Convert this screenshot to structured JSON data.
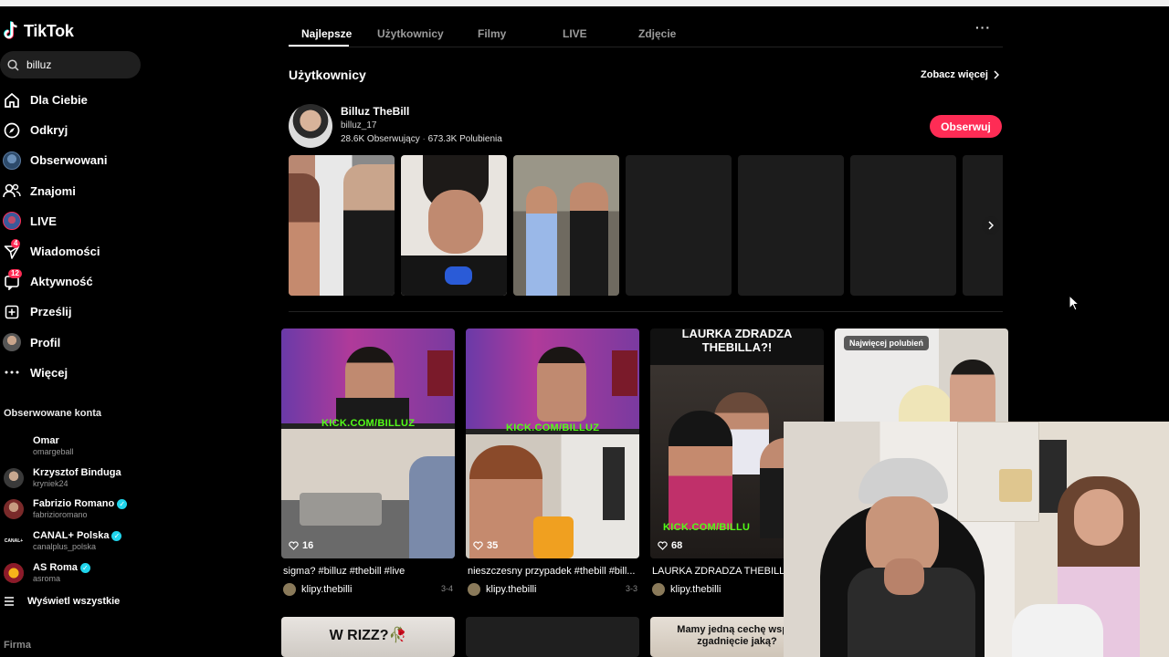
{
  "app": {
    "name": "TikTok"
  },
  "search": {
    "value": "billuz"
  },
  "nav": [
    {
      "label": "Dla Ciebie",
      "icon": "home-icon"
    },
    {
      "label": "Odkryj",
      "icon": "compass-icon"
    },
    {
      "label": "Obserwowani",
      "icon": "avatar-icon"
    },
    {
      "label": "Znajomi",
      "icon": "friends-icon"
    },
    {
      "label": "LIVE",
      "icon": "live-icon"
    },
    {
      "label": "Wiadomości",
      "icon": "send-icon",
      "badge": "4"
    },
    {
      "label": "Aktywność",
      "icon": "activity-icon",
      "badge": "12"
    },
    {
      "label": "Prześlij",
      "icon": "upload-icon"
    },
    {
      "label": "Profil",
      "icon": "profile-avatar-icon"
    },
    {
      "label": "Więcej",
      "icon": "more-icon"
    }
  ],
  "followed": {
    "title": "Obserwowane konta",
    "accounts": [
      {
        "name": "Omar",
        "handle": "omargeball",
        "verified": false
      },
      {
        "name": "Krzysztof Binduga",
        "handle": "kryniek24",
        "verified": false
      },
      {
        "name": "Fabrizio Romano",
        "handle": "fabrizioromano",
        "verified": true
      },
      {
        "name": "CANAL+ Polska",
        "handle": "canalplus_polska",
        "verified": true
      },
      {
        "name": "AS Roma",
        "handle": "asroma",
        "verified": true
      }
    ],
    "show_all": "Wyświetl wszystkie"
  },
  "footer": {
    "company": "Firma"
  },
  "tabs": [
    "Najlepsze",
    "Użytkownicy",
    "Filmy",
    "LIVE",
    "Zdjęcie"
  ],
  "tabs_more": "···",
  "users_section": {
    "title": "Użytkownicy",
    "see_more": "Zobacz więcej",
    "user": {
      "name": "Billuz TheBill",
      "handle": "billuz_17",
      "followers": "28.6K Obserwujący",
      "likes": "673.3K Polubienia",
      "follow_label": "Obserwuj"
    }
  },
  "videos": [
    {
      "likes": "16",
      "title": "sigma? #billuz #thebill #live",
      "author": "klipy.thebilli",
      "date": "3-4",
      "overlay": "KICK.COM/BILLUZ"
    },
    {
      "likes": "35",
      "title": "nieszczesny przypadek #thebill #bill...",
      "author": "klipy.thebilli",
      "date": "3-3",
      "overlay": "KICK.COM/BILLUZ"
    },
    {
      "likes": "68",
      "title": "LAURKA ZDRADZA THEBILLA?!",
      "author": "klipy.thebilli",
      "date": "",
      "overlay": "LAURKA ZDRADZA THEBILLA?!",
      "overlay2": "KICK.COM/BILLU"
    },
    {
      "pill": "Najwięcej polubień"
    }
  ],
  "bottom_row": [
    {
      "overlay": "W RIZZ?🥀"
    },
    {
      "overlay": ""
    },
    {
      "overlay": "Mamy jedną cechę wspól zgadnięcie jaką?"
    }
  ]
}
